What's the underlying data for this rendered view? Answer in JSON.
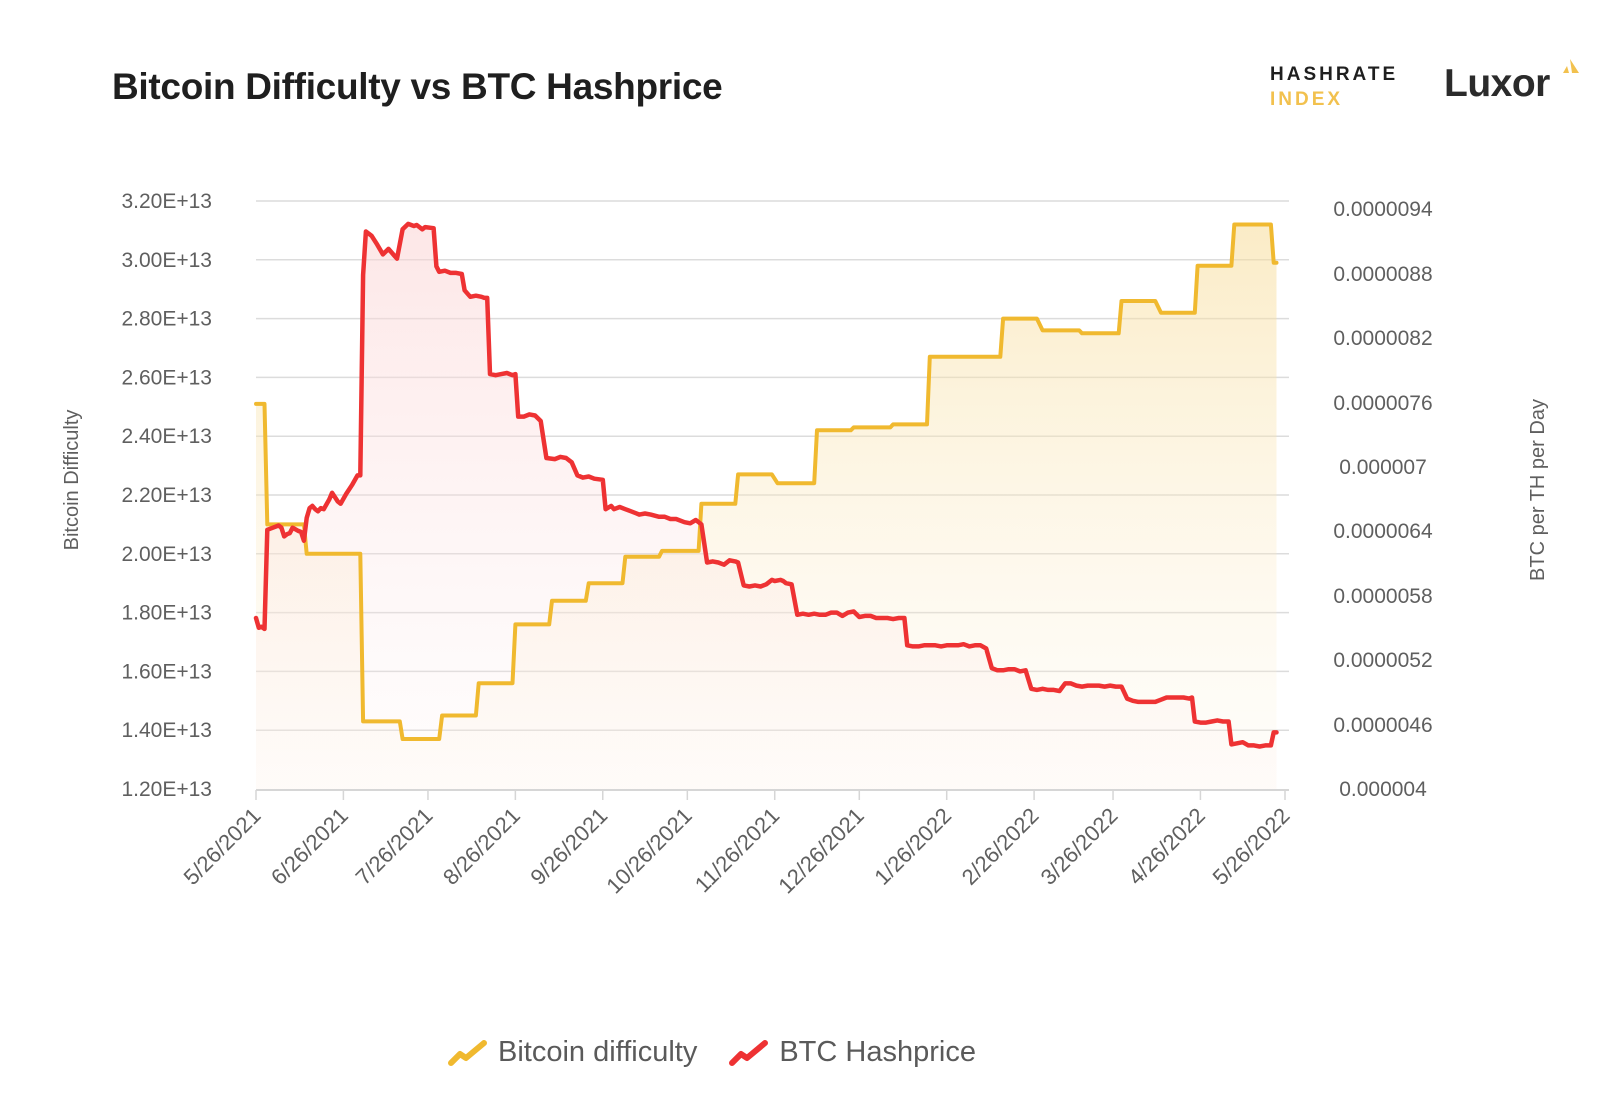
{
  "header": {
    "title": "Bitcoin Difficulty vs BTC Hashprice",
    "logos": {
      "hashrate_index_line1": "HASHRATE",
      "hashrate_index_line2": "INDEX",
      "luxor": "Luxor"
    }
  },
  "colors": {
    "difficulty": "#f0b92f",
    "hashprice": "#ee3233",
    "grid": "#dcdcdc",
    "axis_text": "#5f5f5f",
    "brand_yellow": "#f2c14e"
  },
  "chart_data": {
    "type": "area",
    "title": "Bitcoin Difficulty vs BTC Hashprice",
    "xlabel": "",
    "x_ticks": [
      "5/26/2021",
      "6/26/2021",
      "7/26/2021",
      "8/26/2021",
      "9/26/2021",
      "10/26/2021",
      "11/26/2021",
      "12/26/2021",
      "1/26/2022",
      "2/26/2022",
      "3/26/2022",
      "4/26/2022",
      "5/26/2022"
    ],
    "x_range": [
      "2021-05-26",
      "2022-05-26"
    ],
    "y_left": {
      "label": "Bitcoin Difficulty",
      "range": [
        12000000000000.0,
        32000000000000.0
      ],
      "ticks": [
        "1.20E+13",
        "1.40E+13",
        "1.60E+13",
        "1.80E+13",
        "2.00E+13",
        "2.20E+13",
        "2.40E+13",
        "2.60E+13",
        "2.80E+13",
        "3.00E+13",
        "3.20E+13"
      ],
      "tick_values": [
        12000000000000.0,
        14000000000000.0,
        16000000000000.0,
        18000000000000.0,
        20000000000000.0,
        22000000000000.0,
        24000000000000.0,
        26000000000000.0,
        28000000000000.0,
        30000000000000.0,
        32000000000000.0
      ]
    },
    "y_right": {
      "label": "BTC per TH per Day",
      "range": [
        4e-06,
        9.4e-06
      ],
      "ticks": [
        "0.000004",
        "0.0000046",
        "0.0000052",
        "0.0000058",
        "0.0000064",
        "0.000007",
        "0.0000076",
        "0.0000082",
        "0.0000088",
        "0.0000094"
      ],
      "tick_values": [
        4e-06,
        4.6e-06,
        5.2e-06,
        5.8e-06,
        6.4e-06,
        7e-06,
        7.6e-06,
        8.2e-06,
        8.8e-06,
        9.4e-06
      ]
    },
    "grid": true,
    "legend_position": "bottom-center",
    "series": [
      {
        "name": "Bitcoin difficulty",
        "axis": "left",
        "points": [
          [
            0,
            25100000000000.0
          ],
          [
            3,
            25100000000000.0
          ],
          [
            4,
            21000000000000.0
          ],
          [
            17,
            21000000000000.0
          ],
          [
            18,
            20000000000000.0
          ],
          [
            37,
            20000000000000.0
          ],
          [
            38,
            14300000000000.0
          ],
          [
            51,
            14300000000000.0
          ],
          [
            52,
            13700000000000.0
          ],
          [
            65,
            13700000000000.0
          ],
          [
            66,
            14500000000000.0
          ],
          [
            78,
            14500000000000.0
          ],
          [
            79,
            15600000000000.0
          ],
          [
            91,
            15600000000000.0
          ],
          [
            92,
            17600000000000.0
          ],
          [
            104,
            17600000000000.0
          ],
          [
            105,
            18400000000000.0
          ],
          [
            117,
            18400000000000.0
          ],
          [
            118,
            19000000000000.0
          ],
          [
            130,
            19000000000000.0
          ],
          [
            131,
            19900000000000.0
          ],
          [
            143,
            19900000000000.0
          ],
          [
            144,
            20100000000000.0
          ],
          [
            157,
            20100000000000.0
          ],
          [
            158,
            21700000000000.0
          ],
          [
            170,
            21700000000000.0
          ],
          [
            171,
            22700000000000.0
          ],
          [
            183,
            22700000000000.0
          ],
          [
            185,
            22400000000000.0
          ],
          [
            198,
            22400000000000.0
          ],
          [
            199,
            24200000000000.0
          ],
          [
            211,
            24200000000000.0
          ],
          [
            212,
            24300000000000.0
          ],
          [
            225,
            24300000000000.0
          ],
          [
            226,
            24400000000000.0
          ],
          [
            238,
            24400000000000.0
          ],
          [
            239,
            26700000000000.0
          ],
          [
            251,
            26700000000000.0
          ],
          [
            252,
            26700000000000.0
          ],
          [
            264,
            26700000000000.0
          ],
          [
            265,
            28000000000000.0
          ],
          [
            277,
            28000000000000.0
          ],
          [
            279,
            27600000000000.0
          ],
          [
            292,
            27600000000000.0
          ],
          [
            293,
            27500000000000.0
          ],
          [
            306,
            27500000000000.0
          ],
          [
            307,
            28600000000000.0
          ],
          [
            319,
            28600000000000.0
          ],
          [
            321,
            28200000000000.0
          ],
          [
            333,
            28200000000000.0
          ],
          [
            334,
            29800000000000.0
          ],
          [
            346,
            29800000000000.0
          ],
          [
            347,
            31200000000000.0
          ],
          [
            360,
            31200000000000.0
          ],
          [
            361,
            29900000000000.0
          ],
          [
            362,
            29900000000000.0
          ]
        ]
      },
      {
        "name": "BTC Hashprice",
        "axis": "right",
        "points": [
          [
            0,
            5.57e-06
          ],
          [
            1,
            5.48e-06
          ],
          [
            2,
            5.49e-06
          ],
          [
            3,
            5.47e-06
          ],
          [
            4,
            6.38e-06
          ],
          [
            6,
            6.4e-06
          ],
          [
            8,
            6.42e-06
          ],
          [
            9,
            6.4e-06
          ],
          [
            10,
            6.32e-06
          ],
          [
            11,
            6.34e-06
          ],
          [
            12,
            6.35e-06
          ],
          [
            13,
            6.4e-06
          ],
          [
            15,
            6.37e-06
          ],
          [
            16,
            6.36e-06
          ],
          [
            17,
            6.28e-06
          ],
          [
            18,
            6.49e-06
          ],
          [
            19,
            6.58e-06
          ],
          [
            20,
            6.6e-06
          ],
          [
            21,
            6.57e-06
          ],
          [
            22,
            6.55e-06
          ],
          [
            23,
            6.58e-06
          ],
          [
            24,
            6.57e-06
          ],
          [
            26,
            6.66e-06
          ],
          [
            27,
            6.72e-06
          ],
          [
            29,
            6.64e-06
          ],
          [
            30,
            6.62e-06
          ],
          [
            32,
            6.71e-06
          ],
          [
            34,
            6.79e-06
          ],
          [
            36,
            6.88e-06
          ],
          [
            37,
            6.88e-06
          ],
          [
            38,
            8.72e-06
          ],
          [
            39,
            9.12e-06
          ],
          [
            40,
            9.1e-06
          ],
          [
            41,
            9.08e-06
          ],
          [
            43,
            9e-06
          ],
          [
            45,
            8.91e-06
          ],
          [
            47,
            8.96e-06
          ],
          [
            49,
            8.9e-06
          ],
          [
            50,
            8.87e-06
          ],
          [
            52,
            9.14e-06
          ],
          [
            54,
            9.19e-06
          ],
          [
            56,
            9.17e-06
          ],
          [
            57,
            9.18e-06
          ],
          [
            59,
            9.14e-06
          ],
          [
            60,
            9.16e-06
          ],
          [
            63,
            9.15e-06
          ],
          [
            64,
            8.8e-06
          ],
          [
            65,
            8.75e-06
          ],
          [
            67,
            8.76e-06
          ],
          [
            69,
            8.74e-06
          ],
          [
            71,
            8.74e-06
          ],
          [
            73,
            8.73e-06
          ],
          [
            74,
            8.58e-06
          ],
          [
            76,
            8.52e-06
          ],
          [
            78,
            8.53e-06
          ],
          [
            80,
            8.52e-06
          ],
          [
            81,
            8.51e-06
          ],
          [
            82,
            8.51e-06
          ],
          [
            83,
            7.81e-06
          ],
          [
            85,
            7.8e-06
          ],
          [
            87,
            7.81e-06
          ],
          [
            89,
            7.82e-06
          ],
          [
            90,
            7.81e-06
          ],
          [
            91,
            7.8e-06
          ],
          [
            92,
            7.81e-06
          ],
          [
            93,
            7.42e-06
          ],
          [
            95,
            7.42e-06
          ],
          [
            97,
            7.44e-06
          ],
          [
            99,
            7.43e-06
          ],
          [
            101,
            7.38e-06
          ],
          [
            103,
            7.04e-06
          ],
          [
            106,
            7.03e-06
          ],
          [
            108,
            7.05e-06
          ],
          [
            110,
            7.04e-06
          ],
          [
            112,
            7e-06
          ],
          [
            114,
            6.88e-06
          ],
          [
            116,
            6.86e-06
          ],
          [
            118,
            6.87e-06
          ],
          [
            120,
            6.85e-06
          ],
          [
            123,
            6.84e-06
          ],
          [
            124,
            6.57e-06
          ],
          [
            126,
            6.6e-06
          ],
          [
            127,
            6.57e-06
          ],
          [
            129,
            6.59e-06
          ],
          [
            131,
            6.57e-06
          ],
          [
            133,
            6.55e-06
          ],
          [
            136,
            6.52e-06
          ],
          [
            138,
            6.53e-06
          ],
          [
            140,
            6.52e-06
          ],
          [
            143,
            6.5e-06
          ],
          [
            145,
            6.5e-06
          ],
          [
            147,
            6.48e-06
          ],
          [
            149,
            6.48e-06
          ],
          [
            152,
            6.45e-06
          ],
          [
            154,
            6.44e-06
          ],
          [
            156,
            6.47e-06
          ],
          [
            158,
            6.43e-06
          ],
          [
            160,
            6.08e-06
          ],
          [
            162,
            6.09e-06
          ],
          [
            164,
            6.08e-06
          ],
          [
            166,
            6.06e-06
          ],
          [
            168,
            6.1e-06
          ],
          [
            170,
            6.09e-06
          ],
          [
            171,
            6.08e-06
          ],
          [
            173,
            5.87e-06
          ],
          [
            175,
            5.86e-06
          ],
          [
            177,
            5.87e-06
          ],
          [
            179,
            5.86e-06
          ],
          [
            181,
            5.88e-06
          ],
          [
            183,
            5.92e-06
          ],
          [
            184,
            5.91e-06
          ],
          [
            186,
            5.92e-06
          ],
          [
            187,
            5.91e-06
          ],
          [
            188,
            5.89e-06
          ],
          [
            190,
            5.88e-06
          ],
          [
            192,
            5.6e-06
          ],
          [
            194,
            5.61e-06
          ],
          [
            196,
            5.6e-06
          ],
          [
            198,
            5.61e-06
          ],
          [
            200,
            5.6e-06
          ],
          [
            202,
            5.6e-06
          ],
          [
            204,
            5.62e-06
          ],
          [
            206,
            5.62e-06
          ],
          [
            208,
            5.59e-06
          ],
          [
            210,
            5.62e-06
          ],
          [
            212,
            5.63e-06
          ],
          [
            214,
            5.58e-06
          ],
          [
            216,
            5.59e-06
          ],
          [
            218,
            5.59e-06
          ],
          [
            220,
            5.57e-06
          ],
          [
            222,
            5.57e-06
          ],
          [
            224,
            5.57e-06
          ],
          [
            226,
            5.56e-06
          ],
          [
            228,
            5.57e-06
          ],
          [
            230,
            5.57e-06
          ],
          [
            231,
            5.32e-06
          ],
          [
            233,
            5.31e-06
          ],
          [
            235,
            5.31e-06
          ],
          [
            237,
            5.32e-06
          ],
          [
            239,
            5.32e-06
          ],
          [
            241,
            5.32e-06
          ],
          [
            243,
            5.31e-06
          ],
          [
            245,
            5.32e-06
          ],
          [
            247,
            5.32e-06
          ],
          [
            249,
            5.32e-06
          ],
          [
            251,
            5.33e-06
          ],
          [
            253,
            5.31e-06
          ],
          [
            255,
            5.32e-06
          ],
          [
            257,
            5.32e-06
          ],
          [
            259,
            5.29e-06
          ],
          [
            261,
            5.11e-06
          ],
          [
            263,
            5.09e-06
          ],
          [
            265,
            5.09e-06
          ],
          [
            267,
            5.1e-06
          ],
          [
            269,
            5.1e-06
          ],
          [
            271,
            5.08e-06
          ],
          [
            273,
            5.09e-06
          ],
          [
            275,
            4.92e-06
          ],
          [
            277,
            4.91e-06
          ],
          [
            279,
            4.92e-06
          ],
          [
            281,
            4.91e-06
          ],
          [
            283,
            4.91e-06
          ],
          [
            285,
            4.9e-06
          ],
          [
            287,
            4.97e-06
          ],
          [
            289,
            4.97e-06
          ],
          [
            291,
            4.95e-06
          ],
          [
            293,
            4.94e-06
          ],
          [
            295,
            4.95e-06
          ],
          [
            297,
            4.95e-06
          ],
          [
            299,
            4.95e-06
          ],
          [
            301,
            4.94e-06
          ],
          [
            303,
            4.95e-06
          ],
          [
            305,
            4.94e-06
          ],
          [
            307,
            4.94e-06
          ],
          [
            309,
            4.83e-06
          ],
          [
            311,
            4.81e-06
          ],
          [
            313,
            4.8e-06
          ],
          [
            315,
            4.8e-06
          ],
          [
            317,
            4.8e-06
          ],
          [
            319,
            4.8e-06
          ],
          [
            321,
            4.82e-06
          ],
          [
            323,
            4.84e-06
          ],
          [
            325,
            4.84e-06
          ],
          [
            327,
            4.84e-06
          ],
          [
            329,
            4.84e-06
          ],
          [
            331,
            4.83e-06
          ],
          [
            332,
            4.84e-06
          ],
          [
            333,
            4.62e-06
          ],
          [
            335,
            4.61e-06
          ],
          [
            337,
            4.61e-06
          ],
          [
            339,
            4.62e-06
          ],
          [
            341,
            4.63e-06
          ],
          [
            343,
            4.62e-06
          ],
          [
            345,
            4.62e-06
          ],
          [
            346,
            4.41e-06
          ],
          [
            348,
            4.42e-06
          ],
          [
            350,
            4.43e-06
          ],
          [
            352,
            4.4e-06
          ],
          [
            354,
            4.4e-06
          ],
          [
            356,
            4.39e-06
          ],
          [
            358,
            4.4e-06
          ],
          [
            360,
            4.4e-06
          ],
          [
            361,
            4.52e-06
          ],
          [
            362,
            4.52e-06
          ]
        ]
      }
    ]
  },
  "legend": {
    "items": [
      {
        "label": "Bitcoin difficulty",
        "color": "#f0b92f"
      },
      {
        "label": "BTC Hashprice",
        "color": "#ee3233"
      }
    ]
  }
}
